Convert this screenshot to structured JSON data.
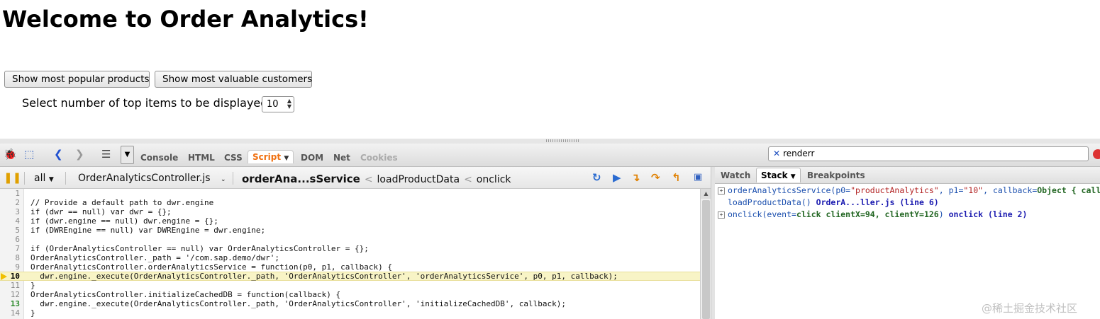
{
  "page": {
    "title": "Welcome to Order Analytics!",
    "buttons": {
      "popular": "Show most popular products",
      "valuable": "Show most valuable customers"
    },
    "select_label": "Select number of top items to be displayed",
    "select_value": "10"
  },
  "firebug": {
    "tabs": [
      "Console",
      "HTML",
      "CSS",
      "Script",
      "DOM",
      "Net",
      "Cookies"
    ],
    "active_tab": "Script",
    "search_value": "renderr",
    "script_filter": "all",
    "file": "OrderAnalyticsController.js",
    "breadcrumb": [
      "orderAna...sService",
      "loadProductData",
      "onclick"
    ],
    "code_lines": [
      "",
      "// Provide a default path to dwr.engine",
      "if (dwr == null) var dwr = {};",
      "if (dwr.engine == null) dwr.engine = {};",
      "if (DWREngine == null) var DWREngine = dwr.engine;",
      "",
      "if (OrderAnalyticsController == null) var OrderAnalyticsController = {};",
      "OrderAnalyticsController._path = '/com.sap.demo/dwr';",
      "OrderAnalyticsController.orderAnalyticsService = function(p0, p1, callback) {",
      "  dwr.engine._execute(OrderAnalyticsController._path, 'OrderAnalyticsController', 'orderAnalyticsService', p0, p1, callback);",
      "}",
      "OrderAnalyticsController.initializeCachedDB = function(callback) {",
      "  dwr.engine._execute(OrderAnalyticsController._path, 'OrderAnalyticsController', 'initializeCachedDB', callback);",
      "}"
    ],
    "line_numbers": [
      "1",
      "2",
      "3",
      "4",
      "5",
      "6",
      "7",
      "8",
      "9",
      "10",
      "11",
      "12",
      "13",
      "14"
    ],
    "current_line": 10,
    "right_tabs": [
      "Watch",
      "Stack",
      "Breakpoints"
    ],
    "active_right_tab": "Stack",
    "stack": {
      "row1": {
        "fn": "orderAnalyticsService(",
        "a1": "p0=",
        "v1": "\"productAnalytics\"",
        "sep1": ", ",
        "a2": "p1=",
        "v2": "\"10\"",
        "sep2": ", ",
        "a3": "callback=",
        "v3": "Object { call"
      },
      "row2": {
        "fn": "loadProductData()",
        "loc": "OrderA...ller.js (line 6)"
      },
      "row3": {
        "fn": "onclick(",
        "a1": "event=",
        "v1": "click clientX=94, clientY=126",
        "close": ")",
        "loc": "onclick (line 2)"
      }
    }
  },
  "watermark": "@稀土掘金技术社区"
}
